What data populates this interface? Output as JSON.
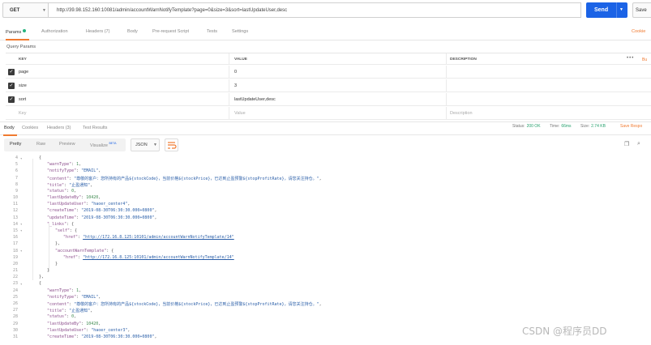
{
  "request": {
    "method": "GET",
    "url": "http://39.98.152.160:10081/admin/accountWarnNotifyTemplate?page=0&size=3&sort=lastUpdateUser,desc",
    "send_label": "Send",
    "save_label": "Save"
  },
  "request_tabs": [
    {
      "label": "Params",
      "active": true
    },
    {
      "label": "Authorization"
    },
    {
      "label": "Headers (7)"
    },
    {
      "label": "Body"
    },
    {
      "label": "Pre-request Script"
    },
    {
      "label": "Tests"
    },
    {
      "label": "Settings"
    }
  ],
  "cookies_label": "Cookie",
  "query_params": {
    "title": "Query Params",
    "columns": {
      "key": "KEY",
      "value": "VALUE",
      "description": "DESCRIPTION"
    },
    "more": "•••",
    "bulk_edit": "Bu",
    "rows": [
      {
        "key": "page",
        "value": "0"
      },
      {
        "key": "size",
        "value": "3"
      },
      {
        "key": "sort",
        "value": "lastUpdateUser,desc"
      }
    ],
    "placeholder": {
      "key": "Key",
      "value": "Value",
      "description": "Description"
    }
  },
  "response_tabs": [
    {
      "label": "Body",
      "active": true
    },
    {
      "label": "Cookies"
    },
    {
      "label": "Headers (3)"
    },
    {
      "label": "Test Results"
    }
  ],
  "status": {
    "status_label": "Status:",
    "status_value": "200 OK",
    "time_label": "Time:",
    "time_value": "66ms",
    "size_label": "Size:",
    "size_value": "2.74 KB",
    "save_response": "Save Respo"
  },
  "viewer": {
    "modes": [
      "Pretty",
      "Raw",
      "Preview",
      "Visualize"
    ],
    "beta": "BETA",
    "format": "JSON"
  },
  "code_lines": [
    {
      "n": "4",
      "fold": true,
      "indent": 1,
      "parts": [
        [
          "p",
          "{"
        ]
      ]
    },
    {
      "n": "5",
      "indent": 2,
      "parts": [
        [
          "k",
          "\"warnType\""
        ],
        [
          "p",
          ": "
        ],
        [
          "n",
          "1"
        ],
        [
          "p",
          ","
        ]
      ]
    },
    {
      "n": "6",
      "indent": 2,
      "parts": [
        [
          "k",
          "\"notifyType\""
        ],
        [
          "p",
          ": "
        ],
        [
          "s",
          "\"EMAIL\""
        ],
        [
          "p",
          ","
        ]
      ]
    },
    {
      "n": "7",
      "indent": 2,
      "parts": [
        [
          "k",
          "\"content\""
        ],
        [
          "p",
          ": "
        ],
        [
          "s",
          "\"尊敬的客户：您所持有的产品${stockCode}，当前价格${stockPrice}，已达到止盈预警${stopProfitRate}，请您关注持仓。\""
        ],
        [
          "p",
          ","
        ]
      ]
    },
    {
      "n": "8",
      "indent": 2,
      "parts": [
        [
          "k",
          "\"title\""
        ],
        [
          "p",
          ": "
        ],
        [
          "s",
          "\"止盈通知\""
        ],
        [
          "p",
          ","
        ]
      ]
    },
    {
      "n": "9",
      "indent": 2,
      "parts": [
        [
          "k",
          "\"status\""
        ],
        [
          "p",
          ": "
        ],
        [
          "n",
          "0"
        ],
        [
          "p",
          ","
        ]
      ]
    },
    {
      "n": "10",
      "indent": 2,
      "parts": [
        [
          "k",
          "\"lastUpdateBy\""
        ],
        [
          "p",
          ": "
        ],
        [
          "n",
          "10420"
        ],
        [
          "p",
          ","
        ]
      ]
    },
    {
      "n": "11",
      "indent": 2,
      "parts": [
        [
          "k",
          "\"lastUpdateUser\""
        ],
        [
          "p",
          ": "
        ],
        [
          "s",
          "\"haoer_center4\""
        ],
        [
          "p",
          ","
        ]
      ]
    },
    {
      "n": "12",
      "indent": 2,
      "parts": [
        [
          "k",
          "\"createTime\""
        ],
        [
          "p",
          ": "
        ],
        [
          "s",
          "\"2019-08-30T06:30:30.000+0800\""
        ],
        [
          "p",
          ","
        ]
      ]
    },
    {
      "n": "13",
      "indent": 2,
      "parts": [
        [
          "k",
          "\"updateTime\""
        ],
        [
          "p",
          ": "
        ],
        [
          "s",
          "\"2019-08-30T06:30:30.000+0800\""
        ],
        [
          "p",
          ","
        ]
      ]
    },
    {
      "n": "14",
      "fold": true,
      "indent": 2,
      "parts": [
        [
          "k",
          "\"_links\""
        ],
        [
          "p",
          ": {"
        ]
      ]
    },
    {
      "n": "15",
      "fold": true,
      "indent": 3,
      "parts": [
        [
          "k",
          "\"self\""
        ],
        [
          "p",
          ": {"
        ]
      ]
    },
    {
      "n": "16",
      "indent": 4,
      "parts": [
        [
          "k",
          "\"href\""
        ],
        [
          "p",
          ": "
        ],
        [
          "u",
          "\"http://172.16.8.125:10101/admin/accountWarnNotifyTemplate/14\""
        ]
      ]
    },
    {
      "n": "17",
      "indent": 3,
      "parts": [
        [
          "p",
          "},"
        ]
      ]
    },
    {
      "n": "18",
      "fold": true,
      "indent": 3,
      "parts": [
        [
          "k",
          "\"accountWarnTemplate\""
        ],
        [
          "p",
          ": {"
        ]
      ]
    },
    {
      "n": "19",
      "indent": 4,
      "parts": [
        [
          "k",
          "\"href\""
        ],
        [
          "p",
          ": "
        ],
        [
          "u",
          "\"http://172.16.8.125:10101/admin/accountWarnNotifyTemplate/14\""
        ]
      ]
    },
    {
      "n": "20",
      "indent": 3,
      "parts": [
        [
          "p",
          "}"
        ]
      ]
    },
    {
      "n": "21",
      "indent": 2,
      "parts": [
        [
          "p",
          "}"
        ]
      ]
    },
    {
      "n": "22",
      "indent": 1,
      "parts": [
        [
          "p",
          "},"
        ]
      ]
    },
    {
      "n": "23",
      "fold": true,
      "indent": 1,
      "parts": [
        [
          "p",
          "{"
        ]
      ]
    },
    {
      "n": "24",
      "indent": 2,
      "parts": [
        [
          "k",
          "\"warnType\""
        ],
        [
          "p",
          ": "
        ],
        [
          "n",
          "1"
        ],
        [
          "p",
          ","
        ]
      ]
    },
    {
      "n": "25",
      "indent": 2,
      "parts": [
        [
          "k",
          "\"notifyType\""
        ],
        [
          "p",
          ": "
        ],
        [
          "s",
          "\"EMAIL\""
        ],
        [
          "p",
          ","
        ]
      ]
    },
    {
      "n": "26",
      "indent": 2,
      "parts": [
        [
          "k",
          "\"content\""
        ],
        [
          "p",
          ": "
        ],
        [
          "s",
          "\"尊敬的客户：您所持有的产品${stockCode}，当前价格${stockPrice}，已达到止盈预警${stopProfitRate}，请您关注持仓。\""
        ],
        [
          "p",
          ","
        ]
      ]
    },
    {
      "n": "27",
      "indent": 2,
      "parts": [
        [
          "k",
          "\"title\""
        ],
        [
          "p",
          ": "
        ],
        [
          "s",
          "\"止盈通知\""
        ],
        [
          "p",
          ","
        ]
      ]
    },
    {
      "n": "28",
      "indent": 2,
      "parts": [
        [
          "k",
          "\"status\""
        ],
        [
          "p",
          ": "
        ],
        [
          "n",
          "0"
        ],
        [
          "p",
          ","
        ]
      ]
    },
    {
      "n": "29",
      "indent": 2,
      "parts": [
        [
          "k",
          "\"lastUpdateBy\""
        ],
        [
          "p",
          ": "
        ],
        [
          "n",
          "10420"
        ],
        [
          "p",
          ","
        ]
      ]
    },
    {
      "n": "30",
      "indent": 2,
      "parts": [
        [
          "k",
          "\"lastUpdateUser\""
        ],
        [
          "p",
          ": "
        ],
        [
          "s",
          "\"haoer_center3\""
        ],
        [
          "p",
          ","
        ]
      ]
    },
    {
      "n": "31",
      "indent": 2,
      "parts": [
        [
          "k",
          "\"createTime\""
        ],
        [
          "p",
          ": "
        ],
        [
          "s",
          "\"2019-08-30T06:30:30.000+0800\""
        ],
        [
          "p",
          ","
        ]
      ]
    }
  ],
  "watermark": "CSDN @程序员DD"
}
